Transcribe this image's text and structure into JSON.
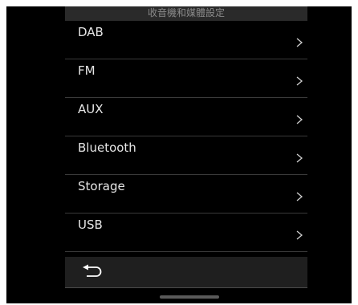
{
  "header": {
    "title": "收音機和媒體設定"
  },
  "menu": {
    "items": [
      {
        "label": "DAB",
        "icon": "chevron-right-icon"
      },
      {
        "label": "FM",
        "icon": "chevron-right-icon"
      },
      {
        "label": "AUX",
        "icon": "chevron-right-icon"
      },
      {
        "label": "Bluetooth",
        "icon": "chevron-right-icon"
      },
      {
        "label": "Storage",
        "icon": "chevron-right-icon"
      },
      {
        "label": "USB",
        "icon": "chevron-right-icon"
      }
    ]
  },
  "footer": {
    "back_icon": "back-arrow-icon"
  },
  "colors": {
    "background": "#000000",
    "header_bg": "#2a2a2a",
    "footer_bg": "#1f1f1f",
    "text": "#e6e6e6",
    "divider": "#3a3a3a"
  }
}
